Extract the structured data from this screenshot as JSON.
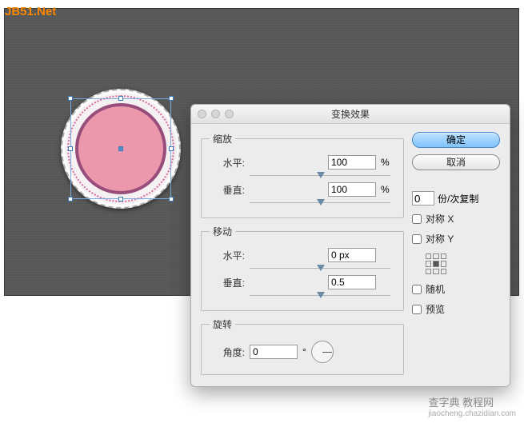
{
  "watermarks": {
    "top_left": "JB51.Net",
    "bottom_right_main": "查字典 教程网",
    "bottom_right_sub": "jiaocheng.chazidian.com"
  },
  "dialog": {
    "title": "变换效果",
    "scale": {
      "legend": "缩放",
      "horizontal_label": "水平:",
      "horizontal_value": "100",
      "horizontal_unit": "%",
      "vertical_label": "垂直:",
      "vertical_value": "100",
      "vertical_unit": "%"
    },
    "move": {
      "legend": "移动",
      "horizontal_label": "水平:",
      "horizontal_value": "0 px",
      "vertical_label": "垂直:",
      "vertical_value": "0.5"
    },
    "rotate": {
      "legend": "旋转",
      "angle_label": "角度:",
      "angle_value": "0",
      "angle_unit": "°"
    },
    "buttons": {
      "ok": "确定",
      "cancel": "取消"
    },
    "copies": {
      "value": "0",
      "label": "份/次复制"
    },
    "options": {
      "reflect_x": "对称 X",
      "reflect_y": "对称 Y",
      "random": "随机",
      "preview": "预览"
    }
  }
}
